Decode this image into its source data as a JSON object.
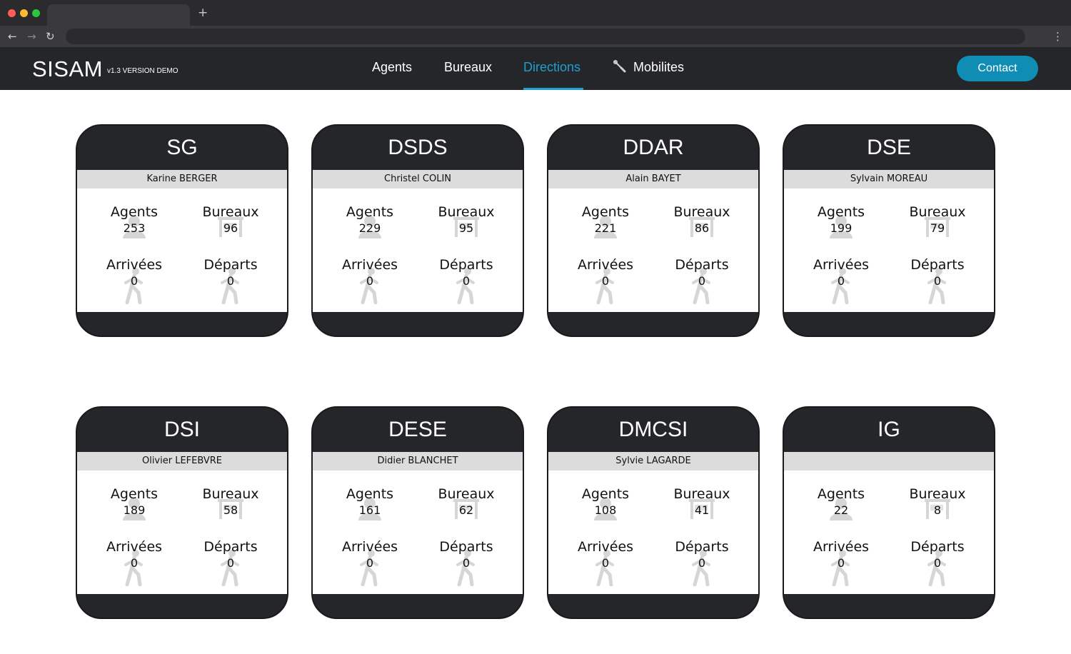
{
  "browser": {
    "new_tab_glyph": "+",
    "back_glyph": "←",
    "forward_glyph": "→",
    "reload_glyph": "↻",
    "menu_glyph": "⋮"
  },
  "header": {
    "logo": "SISAM",
    "version": "v1.3 VERSION DEMO",
    "nav": {
      "agents": "Agents",
      "bureaux": "Bureaux",
      "directions": "Directions",
      "mobilites": "Mobilites"
    },
    "active_nav": "Directions",
    "contact_label": "Contact",
    "accent_color": "#1ea0cf",
    "button_color": "#0f8db5"
  },
  "stat_labels": {
    "agents": "Agents",
    "bureaux": "Bureaux",
    "arrivees": "Arrivées",
    "departs": "Départs"
  },
  "directions": [
    {
      "code": "SG",
      "head": "Karine BERGER",
      "agents": "253",
      "bureaux": "96",
      "arrivees": "0",
      "departs": "0"
    },
    {
      "code": "DSDS",
      "head": "Christel COLIN",
      "agents": "229",
      "bureaux": "95",
      "arrivees": "0",
      "departs": "0"
    },
    {
      "code": "DDAR",
      "head": "Alain BAYET",
      "agents": "221",
      "bureaux": "86",
      "arrivees": "0",
      "departs": "0"
    },
    {
      "code": "DSE",
      "head": "Sylvain MOREAU",
      "agents": "199",
      "bureaux": "79",
      "arrivees": "0",
      "departs": "0"
    },
    {
      "code": "DSI",
      "head": "Olivier LEFEBVRE",
      "agents": "189",
      "bureaux": "58",
      "arrivees": "0",
      "departs": "0"
    },
    {
      "code": "DESE",
      "head": "Didier BLANCHET",
      "agents": "161",
      "bureaux": "62",
      "arrivees": "0",
      "departs": "0"
    },
    {
      "code": "DMCSI",
      "head": "Sylvie LAGARDE",
      "agents": "108",
      "bureaux": "41",
      "arrivees": "0",
      "departs": "0"
    },
    {
      "code": "IG",
      "head": "",
      "agents": "22",
      "bureaux": "8",
      "arrivees": "0",
      "departs": "0"
    }
  ]
}
